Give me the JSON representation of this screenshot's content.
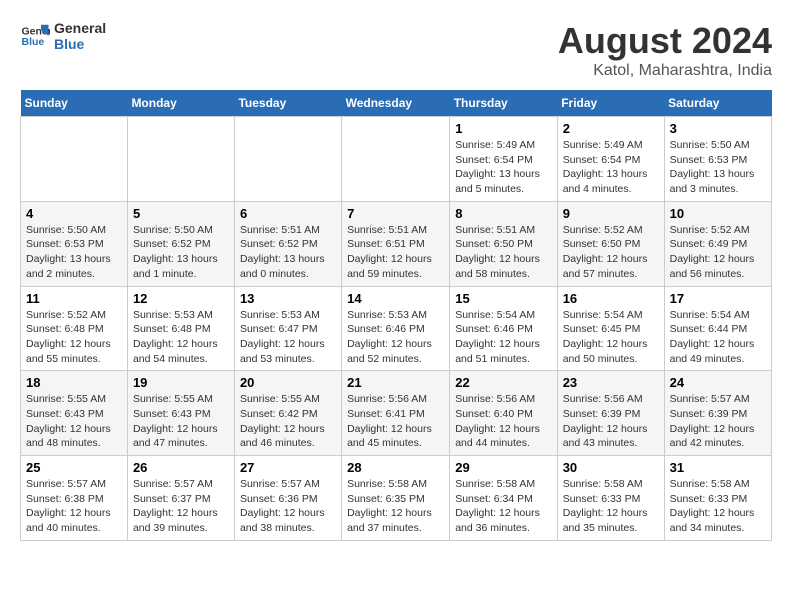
{
  "header": {
    "logo_line1": "General",
    "logo_line2": "Blue",
    "main_title": "August 2024",
    "subtitle": "Katol, Maharashtra, India"
  },
  "weekdays": [
    "Sunday",
    "Monday",
    "Tuesday",
    "Wednesday",
    "Thursday",
    "Friday",
    "Saturday"
  ],
  "weeks": [
    [
      {
        "day": "",
        "info": ""
      },
      {
        "day": "",
        "info": ""
      },
      {
        "day": "",
        "info": ""
      },
      {
        "day": "",
        "info": ""
      },
      {
        "day": "1",
        "info": "Sunrise: 5:49 AM\nSunset: 6:54 PM\nDaylight: 13 hours\nand 5 minutes."
      },
      {
        "day": "2",
        "info": "Sunrise: 5:49 AM\nSunset: 6:54 PM\nDaylight: 13 hours\nand 4 minutes."
      },
      {
        "day": "3",
        "info": "Sunrise: 5:50 AM\nSunset: 6:53 PM\nDaylight: 13 hours\nand 3 minutes."
      }
    ],
    [
      {
        "day": "4",
        "info": "Sunrise: 5:50 AM\nSunset: 6:53 PM\nDaylight: 13 hours\nand 2 minutes."
      },
      {
        "day": "5",
        "info": "Sunrise: 5:50 AM\nSunset: 6:52 PM\nDaylight: 13 hours\nand 1 minute."
      },
      {
        "day": "6",
        "info": "Sunrise: 5:51 AM\nSunset: 6:52 PM\nDaylight: 13 hours\nand 0 minutes."
      },
      {
        "day": "7",
        "info": "Sunrise: 5:51 AM\nSunset: 6:51 PM\nDaylight: 12 hours\nand 59 minutes."
      },
      {
        "day": "8",
        "info": "Sunrise: 5:51 AM\nSunset: 6:50 PM\nDaylight: 12 hours\nand 58 minutes."
      },
      {
        "day": "9",
        "info": "Sunrise: 5:52 AM\nSunset: 6:50 PM\nDaylight: 12 hours\nand 57 minutes."
      },
      {
        "day": "10",
        "info": "Sunrise: 5:52 AM\nSunset: 6:49 PM\nDaylight: 12 hours\nand 56 minutes."
      }
    ],
    [
      {
        "day": "11",
        "info": "Sunrise: 5:52 AM\nSunset: 6:48 PM\nDaylight: 12 hours\nand 55 minutes."
      },
      {
        "day": "12",
        "info": "Sunrise: 5:53 AM\nSunset: 6:48 PM\nDaylight: 12 hours\nand 54 minutes."
      },
      {
        "day": "13",
        "info": "Sunrise: 5:53 AM\nSunset: 6:47 PM\nDaylight: 12 hours\nand 53 minutes."
      },
      {
        "day": "14",
        "info": "Sunrise: 5:53 AM\nSunset: 6:46 PM\nDaylight: 12 hours\nand 52 minutes."
      },
      {
        "day": "15",
        "info": "Sunrise: 5:54 AM\nSunset: 6:46 PM\nDaylight: 12 hours\nand 51 minutes."
      },
      {
        "day": "16",
        "info": "Sunrise: 5:54 AM\nSunset: 6:45 PM\nDaylight: 12 hours\nand 50 minutes."
      },
      {
        "day": "17",
        "info": "Sunrise: 5:54 AM\nSunset: 6:44 PM\nDaylight: 12 hours\nand 49 minutes."
      }
    ],
    [
      {
        "day": "18",
        "info": "Sunrise: 5:55 AM\nSunset: 6:43 PM\nDaylight: 12 hours\nand 48 minutes."
      },
      {
        "day": "19",
        "info": "Sunrise: 5:55 AM\nSunset: 6:43 PM\nDaylight: 12 hours\nand 47 minutes."
      },
      {
        "day": "20",
        "info": "Sunrise: 5:55 AM\nSunset: 6:42 PM\nDaylight: 12 hours\nand 46 minutes."
      },
      {
        "day": "21",
        "info": "Sunrise: 5:56 AM\nSunset: 6:41 PM\nDaylight: 12 hours\nand 45 minutes."
      },
      {
        "day": "22",
        "info": "Sunrise: 5:56 AM\nSunset: 6:40 PM\nDaylight: 12 hours\nand 44 minutes."
      },
      {
        "day": "23",
        "info": "Sunrise: 5:56 AM\nSunset: 6:39 PM\nDaylight: 12 hours\nand 43 minutes."
      },
      {
        "day": "24",
        "info": "Sunrise: 5:57 AM\nSunset: 6:39 PM\nDaylight: 12 hours\nand 42 minutes."
      }
    ],
    [
      {
        "day": "25",
        "info": "Sunrise: 5:57 AM\nSunset: 6:38 PM\nDaylight: 12 hours\nand 40 minutes."
      },
      {
        "day": "26",
        "info": "Sunrise: 5:57 AM\nSunset: 6:37 PM\nDaylight: 12 hours\nand 39 minutes."
      },
      {
        "day": "27",
        "info": "Sunrise: 5:57 AM\nSunset: 6:36 PM\nDaylight: 12 hours\nand 38 minutes."
      },
      {
        "day": "28",
        "info": "Sunrise: 5:58 AM\nSunset: 6:35 PM\nDaylight: 12 hours\nand 37 minutes."
      },
      {
        "day": "29",
        "info": "Sunrise: 5:58 AM\nSunset: 6:34 PM\nDaylight: 12 hours\nand 36 minutes."
      },
      {
        "day": "30",
        "info": "Sunrise: 5:58 AM\nSunset: 6:33 PM\nDaylight: 12 hours\nand 35 minutes."
      },
      {
        "day": "31",
        "info": "Sunrise: 5:58 AM\nSunset: 6:33 PM\nDaylight: 12 hours\nand 34 minutes."
      }
    ]
  ]
}
